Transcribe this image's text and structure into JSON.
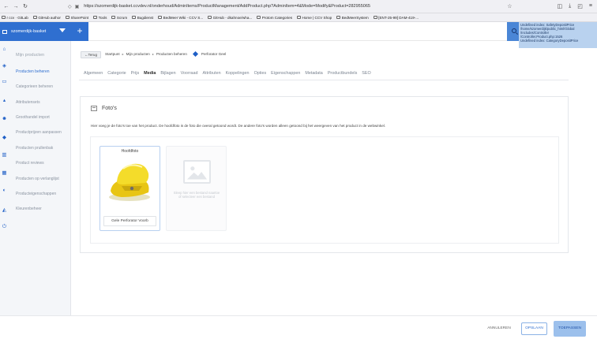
{
  "browser": {
    "url": "https://szomerdijk-basket.ccvdev.nl/onderhoud/AdminItems/ProductManagement/AddProduct.php?AdminItem=4&Mode=Modify&Product=282955065",
    "bookmarks": [
      "r ccv · GitLab",
      "GitHub author",
      "SharePoint",
      "Tools",
      "Scrum",
      "Bugdienst",
      "BedMeer Wiki - CCV S...",
      "GitHub - dkahnoe/wha...",
      "Protom Categories",
      "Home | CCV Shop",
      "BedMeerSystem",
      "[ENT-25-99] DAM-419-..."
    ]
  },
  "sidebar": {
    "store_name": "szomerdijk-basket",
    "section_header": "Mijn producten",
    "items": [
      "Producten beheren",
      "Categorieen beheren",
      "Attributensets",
      "Groothandel import",
      "Productprijzen aanpassen",
      "Producten prullenbak",
      "Product reviews",
      "Producten op verlanglijst",
      "Producteigenschappen",
      "Kleurenbeheer"
    ]
  },
  "topbar": {
    "add_label": "+",
    "error_lines": [
      "Undefined index: SafetyDepositPrice",
      "/home/szomerdijk/public_html/Global",
      "/Includes/Controller",
      "/Controller.Product.php:1526",
      "Undefined index: CategoryDepositPrice"
    ]
  },
  "breadcrumb": {
    "back": "Terug",
    "items": [
      "Startpunt",
      "Mijn producten",
      "Producten beheren"
    ],
    "current": "Perforator Geel"
  },
  "tabs": [
    "Algemeen",
    "Categorie",
    "Prijs",
    "Media",
    "Bijlagen",
    "Voorraad",
    "Attributen",
    "Koppelingen",
    "Opties",
    "Eigenschappen",
    "Metadata",
    "Productbundels",
    "SEO"
  ],
  "active_tab": "Media",
  "media": {
    "title": "Foto's",
    "description": "Hier voeg je de foto's toe van het product. De hoofdfoto is de foto die overal getoond wordt. De andere foto's worden alleen getoond bij het weergeven van het product in de webwinkel.",
    "main_photo_label": "Hoofdfoto",
    "main_photo_caption": "Gele Perforator Voorb",
    "drop_text": "Sleep hier een bestand naartoe of selecteer een bestand"
  },
  "footer": {
    "cancel": "ANNULEREN",
    "save": "OPSLAAN",
    "apply": "TOEPASSEN"
  },
  "colors": {
    "brand_blue": "#2f6fd0",
    "apply_button": "#9cc0ec",
    "product_yellow": "#f2d21b"
  }
}
